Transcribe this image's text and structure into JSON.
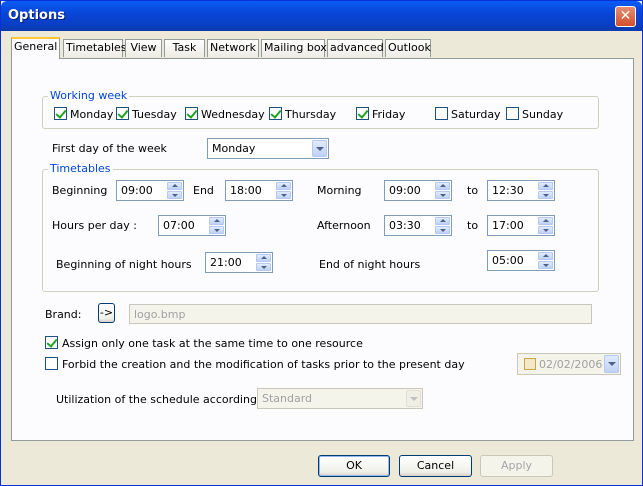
{
  "window": {
    "title": "Options",
    "close_label": "✕"
  },
  "tabs": [
    "General",
    "Timetables",
    "View",
    "Task",
    "Network",
    "Mailing box",
    "advanced",
    "Outlook"
  ],
  "working_week": {
    "label": "Working week",
    "days": [
      {
        "label": "Monday",
        "checked": true
      },
      {
        "label": "Tuesday",
        "checked": true
      },
      {
        "label": "Wednesday",
        "checked": true
      },
      {
        "label": "Thursday",
        "checked": true
      },
      {
        "label": "Friday",
        "checked": true
      },
      {
        "label": "Saturday",
        "checked": false
      },
      {
        "label": "Sunday",
        "checked": false
      }
    ]
  },
  "first_day": {
    "label": "First day of the week",
    "value": "Monday"
  },
  "timetables": {
    "label": "Timetables",
    "beginning_label": "Beginning",
    "beginning": "09:00",
    "end_label": "End",
    "end": "18:00",
    "morning_label": "Morning",
    "morning_from": "09:00",
    "to_label": "to",
    "morning_to": "12:30",
    "hours_per_day_label": "Hours per day :",
    "hours_per_day": "07:00",
    "afternoon_label": "Afternoon",
    "afternoon_from": "03:30",
    "afternoon_to": "17:00",
    "night_begin_label": "Beginning of night hours",
    "night_begin": "21:00",
    "night_end_label": "End of night hours",
    "night_end": "05:00"
  },
  "brand": {
    "label": "Brand:",
    "button_label": "->",
    "value": "logo.bmp"
  },
  "options": {
    "assign_one_task": {
      "label": "Assign only one task at the same time to one resource",
      "checked": true
    },
    "forbid_prior": {
      "label": "Forbid the creation and the modification of tasks prior to the present day",
      "checked": false
    },
    "date": "02/02/2006"
  },
  "utilization": {
    "label": "Utilization of the schedule according to",
    "value": "Standard"
  },
  "buttons": {
    "ok": "OK",
    "cancel": "Cancel",
    "apply": "Apply"
  }
}
